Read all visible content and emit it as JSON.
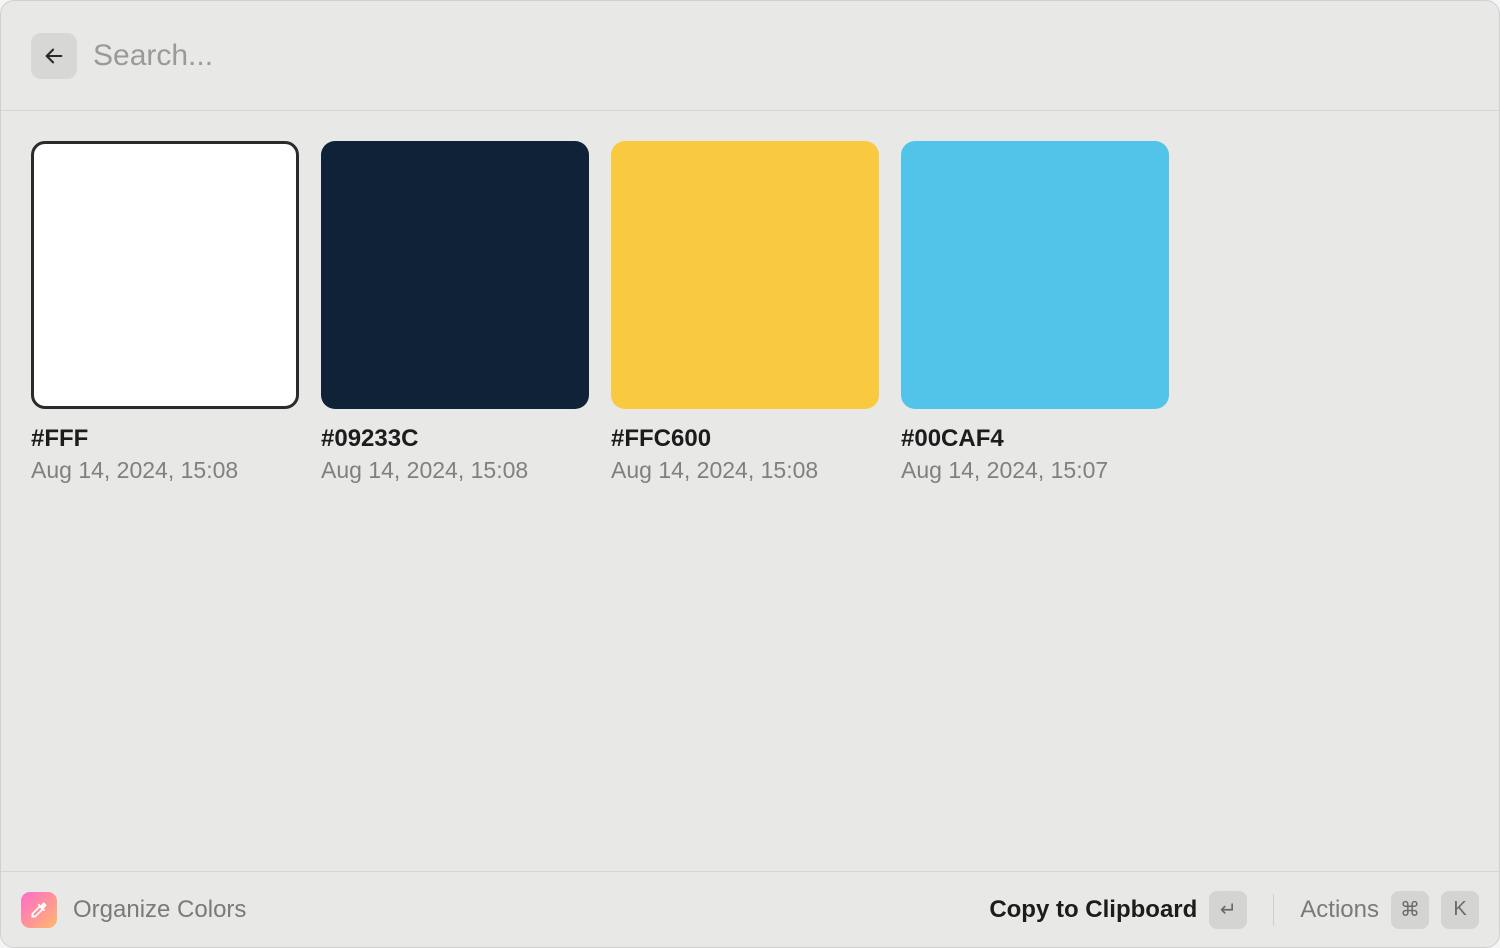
{
  "header": {
    "search_placeholder": "Search..."
  },
  "colors": [
    {
      "hex": "#FFF",
      "swatch": "#FFFFFF",
      "timestamp": "Aug 14, 2024, 15:08",
      "selected": true
    },
    {
      "hex": "#09233C",
      "swatch": "#0f2238",
      "timestamp": "Aug 14, 2024, 15:08",
      "selected": false
    },
    {
      "hex": "#FFC600",
      "swatch": "#f9ca3f",
      "timestamp": "Aug 14, 2024, 15:08",
      "selected": false
    },
    {
      "hex": "#00CAF4",
      "swatch": "#52c4ea",
      "timestamp": "Aug 14, 2024, 15:07",
      "selected": false
    }
  ],
  "footer": {
    "app_name": "Organize Colors",
    "primary_action": "Copy to Clipboard",
    "secondary_action": "Actions",
    "key_enter": "↵",
    "key_cmd": "⌘",
    "key_k": "K"
  }
}
